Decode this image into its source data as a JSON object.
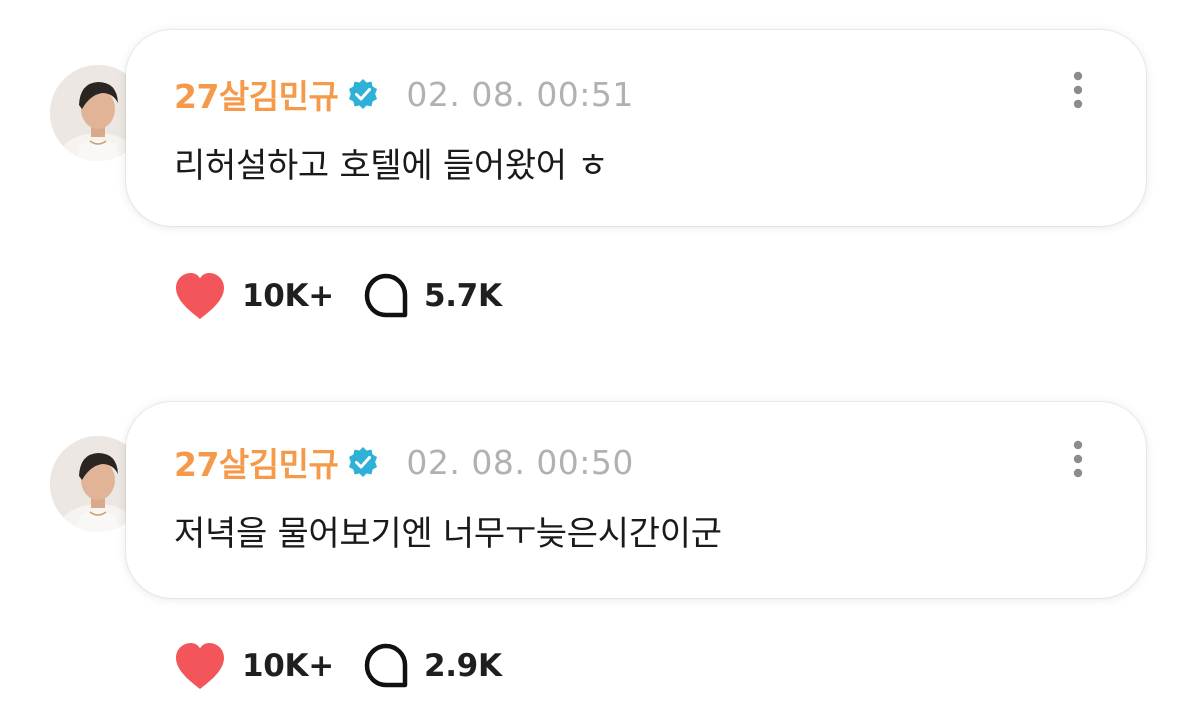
{
  "colors": {
    "username": "#f49a4a",
    "verified": "#2fb0d6",
    "heart": "#f2565b",
    "timestamp": "#b1b1b1",
    "text": "#1a1a1a"
  },
  "icons": {
    "verified": "verified-badge-icon",
    "more": "more-vertical-icon",
    "like": "heart-icon",
    "comment": "comment-bubble-icon"
  },
  "posts": [
    {
      "username": "27살김민규",
      "timestamp": "02. 08. 00:51",
      "message": "리허설하고 호텔에 들어왔어 ㅎ",
      "likes": "10K+",
      "comments": "5.7K"
    },
    {
      "username": "27살김민규",
      "timestamp": "02. 08. 00:50",
      "message": "저녁을 물어보기엔 너무ㅜ늦은시간이군",
      "likes": "10K+",
      "comments": "2.9K"
    }
  ]
}
